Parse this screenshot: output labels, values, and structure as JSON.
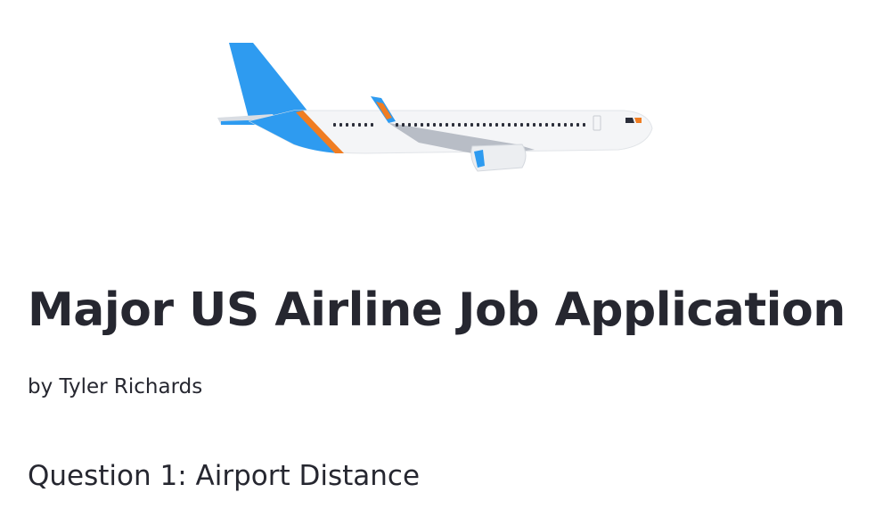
{
  "hero": {
    "image_subject": "airplane",
    "colors": {
      "tail": "#2E9BF0",
      "stripe": "#F07D22",
      "fuselage": "#F4F5F7",
      "window": "#2B2E3A",
      "wing": "#B8BDC6"
    }
  },
  "header": {
    "title": "Major US Airline Job Application",
    "byline": "by Tyler Richards"
  },
  "section": {
    "heading": "Question 1: Airport Distance"
  },
  "theme": {
    "text": "#262730",
    "background": "#FFFFFF"
  }
}
